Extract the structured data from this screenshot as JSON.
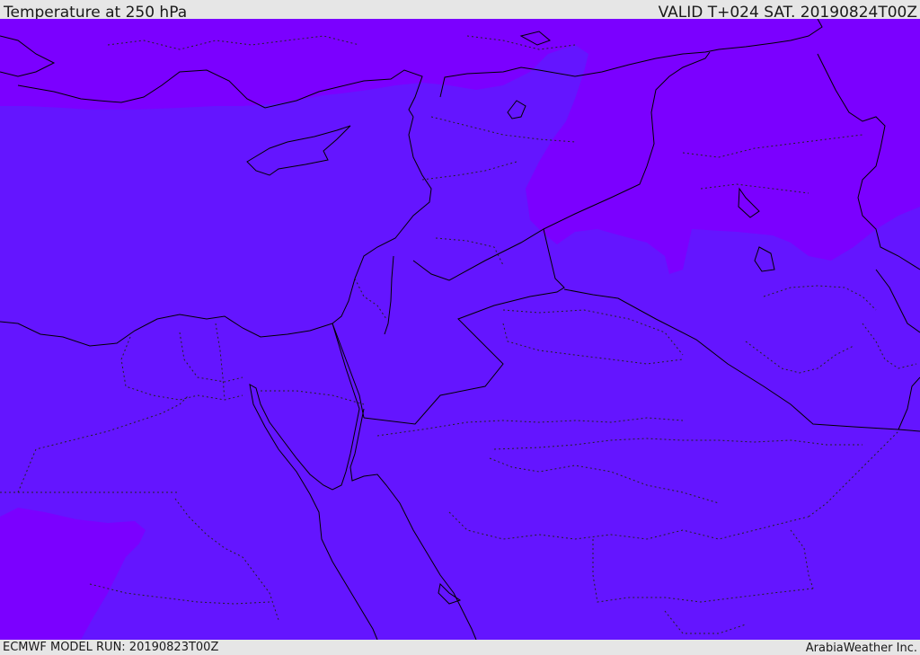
{
  "header": {
    "title": "Temperature at 250 hPa",
    "valid": "VALID T+024 SAT. 20190824T00Z"
  },
  "footer": {
    "model_run": "ECMWF MODEL RUN: 20190823T00Z",
    "credit": "ArabiaWeather Inc."
  },
  "map": {
    "field": "temperature-250hPa",
    "colors": {
      "base_fill": "#6415ff",
      "cold_fill": "#7b00ff",
      "coastline": "#000000",
      "border_dotted": "#222222"
    }
  }
}
